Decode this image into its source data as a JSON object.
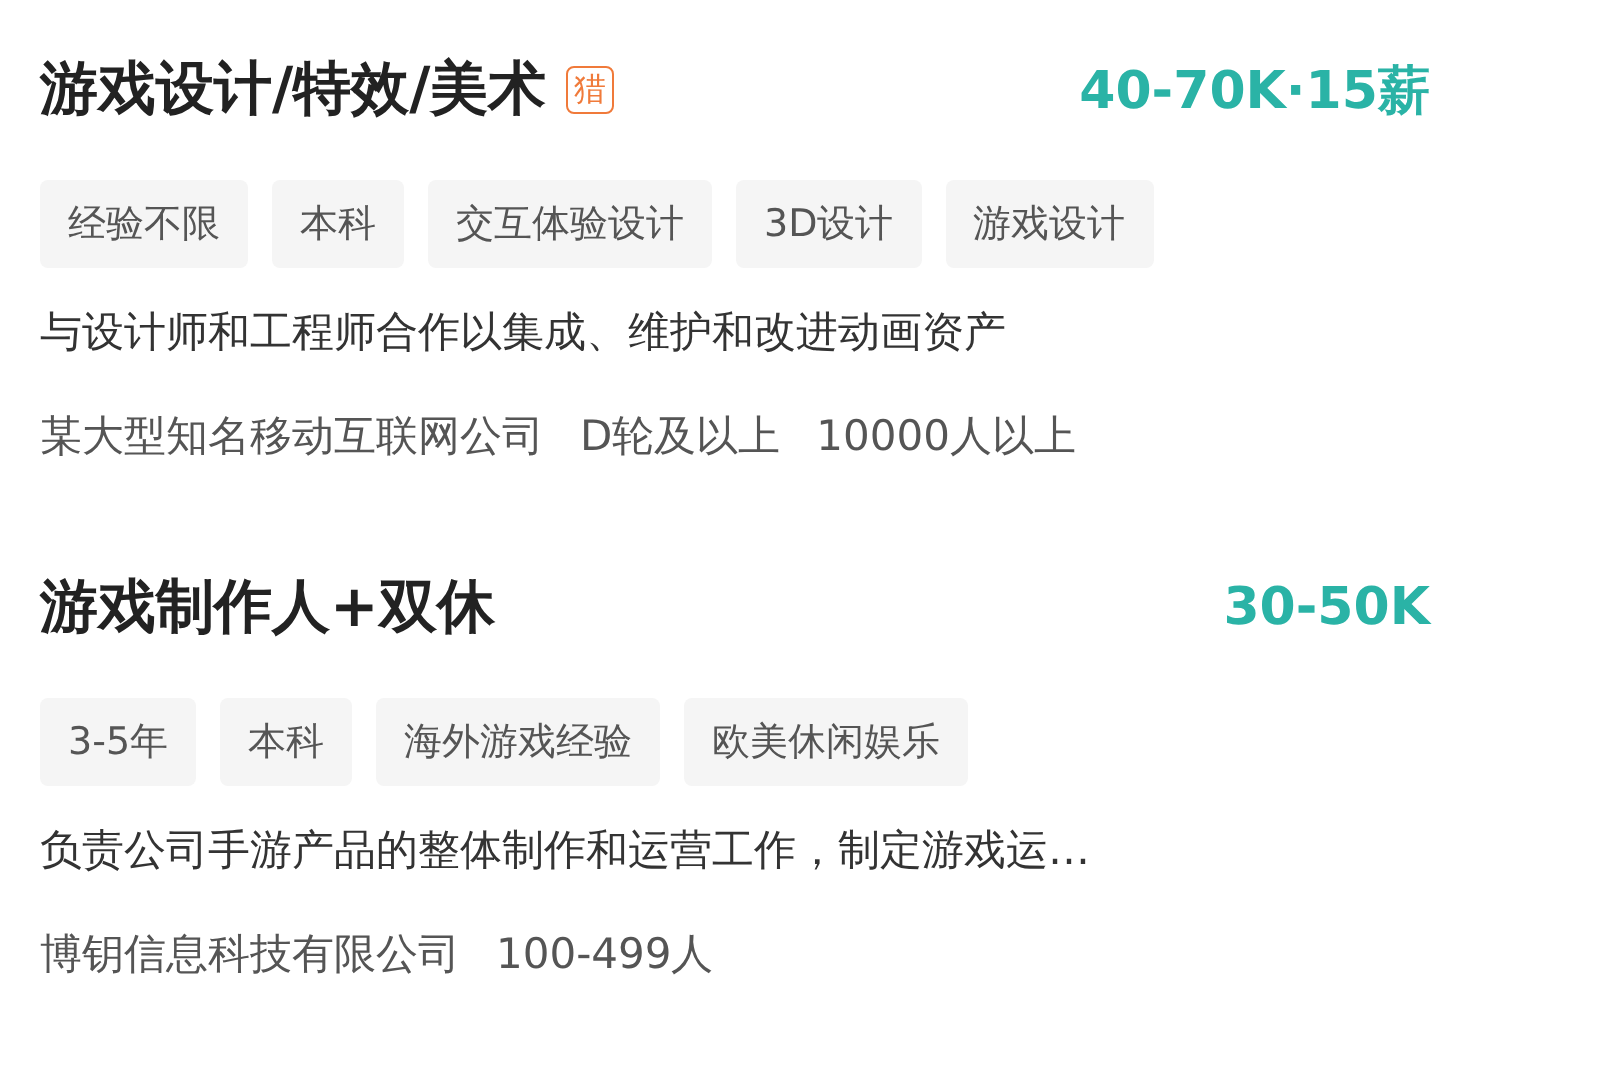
{
  "jobs": [
    {
      "title": "游戏设计/特效/美术",
      "badge": "猎",
      "salary": "40-70K·15薪",
      "tags": [
        "经验不限",
        "本科",
        "交互体验设计",
        "3D设计",
        "游戏设计"
      ],
      "description": "与设计师和工程师合作以集成、维护和改进动画资产",
      "company_info": [
        "某大型知名移动互联网公司",
        "D轮及以上",
        "10000人以上"
      ]
    },
    {
      "title": "游戏制作人+双休",
      "salary": "30-50K",
      "tags": [
        "3-5年",
        "本科",
        "海外游戏经验",
        "欧美休闲娱乐"
      ],
      "description": "负责公司手游产品的整体制作和运营工作，制定游戏运…",
      "company_info": [
        "博钥信息科技有限公司",
        "100-499人"
      ]
    }
  ]
}
